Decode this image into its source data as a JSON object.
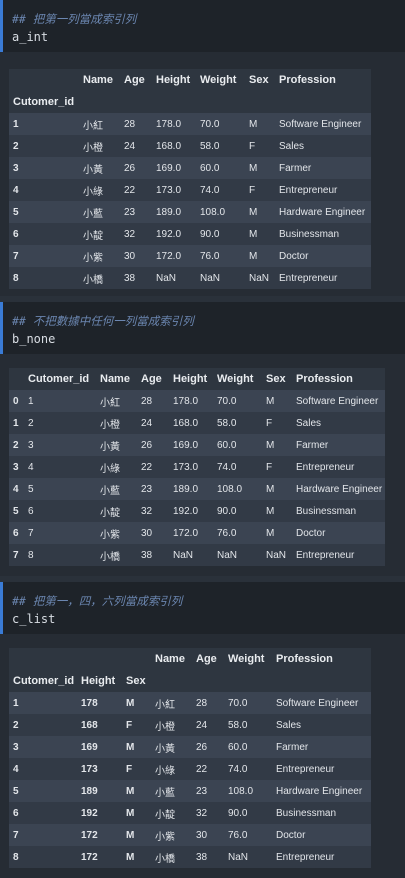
{
  "cells": [
    {
      "comment": "## 把第一列當成索引列",
      "code": "a_int",
      "header_row": [
        "",
        "Name",
        "Age",
        "Height",
        "Weight",
        "Sex",
        "Profession"
      ],
      "index_header": "Cutomer_id",
      "rows": [
        [
          "1",
          "小紅",
          "28",
          "178.0",
          "70.0",
          "M",
          "Software Engineer"
        ],
        [
          "2",
          "小橙",
          "24",
          "168.0",
          "58.0",
          "F",
          "Sales"
        ],
        [
          "3",
          "小黃",
          "26",
          "169.0",
          "60.0",
          "M",
          "Farmer"
        ],
        [
          "4",
          "小綠",
          "22",
          "173.0",
          "74.0",
          "F",
          "Entrepreneur"
        ],
        [
          "5",
          "小藍",
          "23",
          "189.0",
          "108.0",
          "M",
          "Hardware Engineer"
        ],
        [
          "6",
          "小靛",
          "32",
          "192.0",
          "90.0",
          "M",
          "Businessman"
        ],
        [
          "7",
          "小紫",
          "30",
          "172.0",
          "76.0",
          "M",
          "Doctor"
        ],
        [
          "8",
          "小橋",
          "38",
          "NaN",
          "NaN",
          "NaN",
          "Entrepreneur"
        ]
      ]
    },
    {
      "comment": "## 不把數據中任何一列當成索引列",
      "code": "b_none",
      "header_row": [
        "",
        "Cutomer_id",
        "Name",
        "Age",
        "Height",
        "Weight",
        "Sex",
        "Profession"
      ],
      "rows": [
        [
          "0",
          "1",
          "小紅",
          "28",
          "178.0",
          "70.0",
          "M",
          "Software Engineer"
        ],
        [
          "1",
          "2",
          "小橙",
          "24",
          "168.0",
          "58.0",
          "F",
          "Sales"
        ],
        [
          "2",
          "3",
          "小黃",
          "26",
          "169.0",
          "60.0",
          "M",
          "Farmer"
        ],
        [
          "3",
          "4",
          "小綠",
          "22",
          "173.0",
          "74.0",
          "F",
          "Entrepreneur"
        ],
        [
          "4",
          "5",
          "小藍",
          "23",
          "189.0",
          "108.0",
          "M",
          "Hardware Engineer"
        ],
        [
          "5",
          "6",
          "小靛",
          "32",
          "192.0",
          "90.0",
          "M",
          "Businessman"
        ],
        [
          "6",
          "7",
          "小紫",
          "30",
          "172.0",
          "76.0",
          "M",
          "Doctor"
        ],
        [
          "7",
          "8",
          "小橋",
          "38",
          "NaN",
          "NaN",
          "NaN",
          "Entrepreneur"
        ]
      ]
    },
    {
      "comment": "## 把第一，四，六列當成索引列",
      "code": "c_list",
      "header_row": [
        "",
        "",
        "",
        "Name",
        "Age",
        "Weight",
        "Profession"
      ],
      "index_header": [
        "Cutomer_id",
        "Height",
        "Sex"
      ],
      "rows": [
        [
          "1",
          "178",
          "M",
          "小紅",
          "28",
          "70.0",
          "Software Engineer"
        ],
        [
          "2",
          "168",
          "F",
          "小橙",
          "24",
          "58.0",
          "Sales"
        ],
        [
          "3",
          "169",
          "M",
          "小黃",
          "26",
          "60.0",
          "Farmer"
        ],
        [
          "4",
          "173",
          "F",
          "小綠",
          "22",
          "74.0",
          "Entrepreneur"
        ],
        [
          "5",
          "189",
          "M",
          "小藍",
          "23",
          "108.0",
          "Hardware Engineer"
        ],
        [
          "6",
          "192",
          "M",
          "小靛",
          "32",
          "90.0",
          "Businessman"
        ],
        [
          "7",
          "172",
          "M",
          "小紫",
          "30",
          "76.0",
          "Doctor"
        ],
        [
          "8",
          "172",
          "M",
          "小橋",
          "38",
          "NaN",
          "Entrepreneur"
        ]
      ]
    }
  ]
}
